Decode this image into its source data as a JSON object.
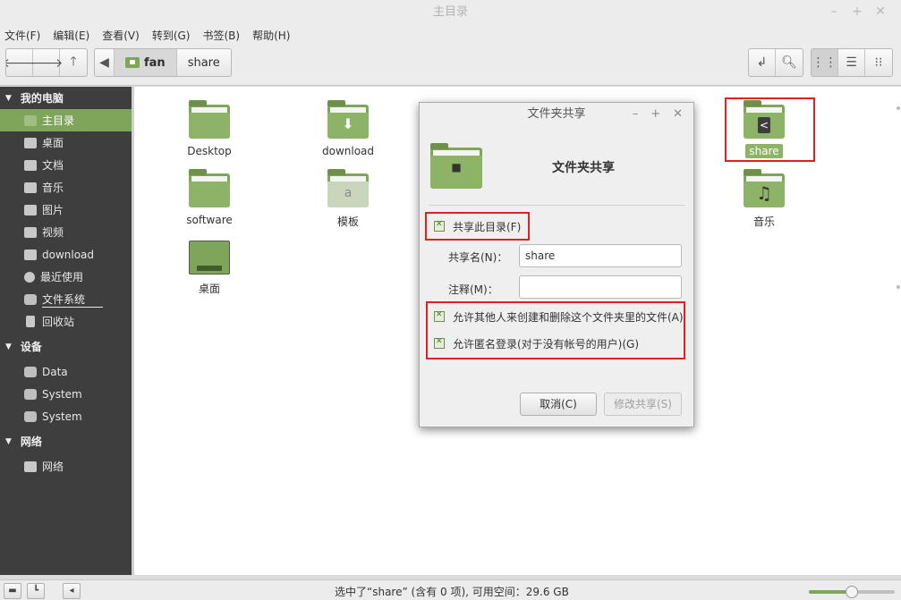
{
  "window": {
    "title": "主目录"
  },
  "menu": [
    "文件(F)",
    "编辑(E)",
    "查看(V)",
    "转到(G)",
    "书签(B)",
    "帮助(H)"
  ],
  "toolbar": {
    "nav_icons": [
      "back-arrow-icon",
      "forward-arrow-icon",
      "up-arrow-icon"
    ],
    "path": [
      "fan",
      "share"
    ],
    "right_icons": [
      "toggle-location-icon",
      "search-icon"
    ],
    "view_icons": [
      "icon-view-icon",
      "list-view-icon",
      "compact-view-icon"
    ]
  },
  "sidebar": {
    "sections": [
      {
        "title": "我的电脑",
        "items": [
          "主目录",
          "桌面",
          "文档",
          "音乐",
          "图片",
          "视频",
          "download",
          "最近使用",
          "文件系统",
          "回收站"
        ]
      },
      {
        "title": "设备",
        "items": [
          "Data",
          "System",
          "System"
        ]
      },
      {
        "title": "网络",
        "items": [
          "网络"
        ]
      }
    ]
  },
  "files": [
    {
      "name": "Desktop",
      "icon": "folder-icon"
    },
    {
      "name": "download",
      "icon": "download-folder-icon"
    },
    {
      "name": "share",
      "icon": "share-folder-icon",
      "selected": true
    },
    {
      "name": "software",
      "icon": "folder-icon"
    },
    {
      "name": "模板",
      "icon": "templates-folder-icon"
    },
    {
      "name": "音乐",
      "icon": "music-folder-icon"
    },
    {
      "name": "桌面",
      "icon": "desktop-folder-icon"
    }
  ],
  "dialog": {
    "title": "文件夹共享",
    "heading": "文件夹共享",
    "share_this": "共享此目录(F)",
    "share_name_label": "共享名(N)：",
    "share_name_value": "share",
    "comment_label": "注释(M)：",
    "comment_value": "",
    "allow_others": "允许其他人来创建和删除这个文件夹里的文件(A)",
    "allow_guest": "允许匿名登录(对于没有帐号的用户)(G)",
    "cancel": "取消(C)",
    "modify": "修改共享(S)"
  },
  "status": {
    "text": "选中了“share” (含有 0 项), 可用空间：29.6 GB",
    "zoom": 0.5
  },
  "colors": {
    "accent": "#7fa55a",
    "sidebar_bg": "#3e3e3e",
    "highlight": "#e02020"
  }
}
